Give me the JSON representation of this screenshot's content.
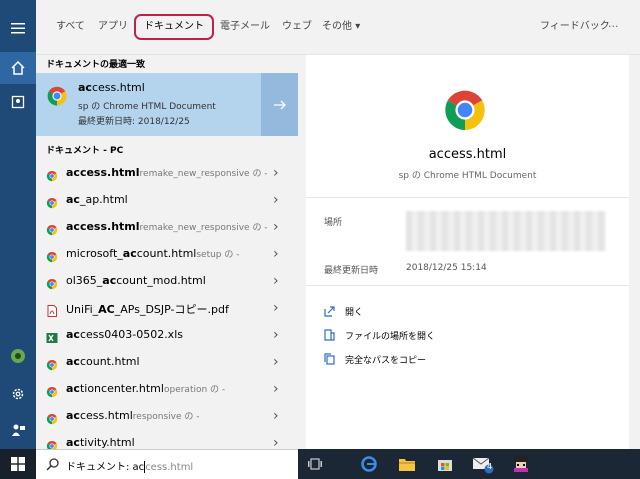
{
  "tabs": {
    "all": "すべて",
    "apps": "アプリ",
    "documents": "ドキュメント",
    "email": "電子メール",
    "web": "ウェブ",
    "more": "その他",
    "feedback": "フィードバック",
    "overflow": "···"
  },
  "best_match": {
    "header": "ドキュメントの最適一致",
    "name_bold": "ac",
    "name_rest": "cess.html",
    "line2": "sp の Chrome HTML Document",
    "line3": "最終更新日時: 2018/12/25"
  },
  "pc_header": "ドキュメント - PC",
  "results": [
    {
      "b": "access.html",
      "rest": "",
      "sub": "remake_new_responsive の -",
      "icon": "chrome-icon"
    },
    {
      "b": "ac",
      "rest": "_ap.html",
      "sub": "",
      "icon": "chrome-icon"
    },
    {
      "b": "access.html",
      "rest": "",
      "sub": "remake_new_responsive の -",
      "icon": "chrome-icon"
    },
    {
      "pre": "microsoft_",
      "b": "ac",
      "rest": "count.html",
      "sub": "setup の -",
      "icon": "chrome-icon"
    },
    {
      "pre": "ol365_",
      "b": "ac",
      "rest": "count_mod.html",
      "sub": "",
      "icon": "chrome-icon"
    },
    {
      "pre": "UniFi_",
      "b": "AC",
      "rest": "_APs_DSJP-コピー.pdf",
      "sub": "",
      "icon": "pdf-icon"
    },
    {
      "b": "ac",
      "rest": "cess0403-0502.xls",
      "sub": "",
      "icon": "excel-icon"
    },
    {
      "b": "ac",
      "rest": "count.html",
      "sub": "",
      "icon": "chrome-icon"
    },
    {
      "b": "ac",
      "rest": "tioncenter.html",
      "sub": "operation の -",
      "icon": "chrome-icon"
    },
    {
      "b": "ac",
      "rest": "cess.html",
      "sub": "responsive の -",
      "icon": "chrome-icon"
    },
    {
      "b": "ac",
      "rest": "tivity.html",
      "sub": "",
      "icon": "chrome-icon"
    }
  ],
  "detail": {
    "title": "access.html",
    "subtitle": "sp の Chrome HTML Document",
    "location_label": "場所",
    "modified_label": "最終更新日時",
    "modified_value": "2018/12/25 15:14",
    "actions": [
      "開く",
      "ファイルの場所を開く",
      "完全なパスをコピー"
    ]
  },
  "search": {
    "typed": "ドキュメント: ac",
    "hint": "cess.html"
  },
  "taskbar": {
    "badge_count": "4"
  },
  "colors": {
    "rail": "#1f4a78",
    "best_match_bg": "#b4d4ee",
    "tab_highlight": "#c0214b",
    "taskbar": "#1c2735"
  }
}
